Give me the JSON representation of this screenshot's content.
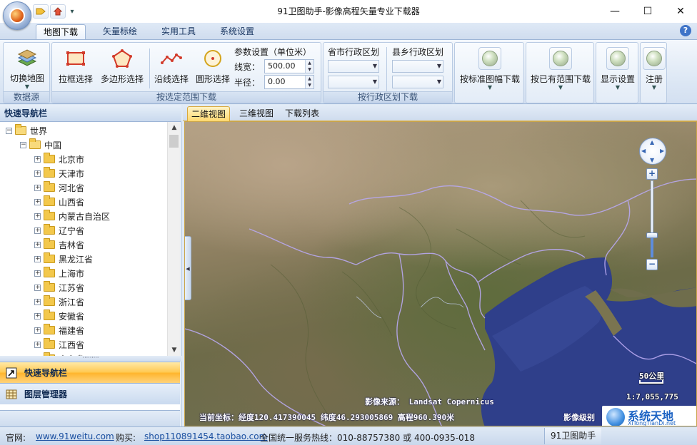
{
  "window": {
    "title": "91卫图助手-影像高程矢量专业下载器",
    "controls": {
      "minimize": "—",
      "maximize": "☐",
      "close": "✕"
    }
  },
  "quick_access": {
    "icons": [
      "tag-icon",
      "home-icon"
    ],
    "dropdown": "▾"
  },
  "ribbon": {
    "tabs": [
      {
        "label": "地图下载",
        "active": true
      },
      {
        "label": "矢量标绘",
        "active": false
      },
      {
        "label": "实用工具",
        "active": false
      },
      {
        "label": "系统设置",
        "active": false
      }
    ],
    "help": "?",
    "groups": {
      "datasource": {
        "label": "数据源",
        "switch_map": "切换地图"
      },
      "range": {
        "label": "按选定范围下载",
        "rect_select": "拉框选择",
        "polygon_select": "多边形选择",
        "line_select": "沿线选择",
        "circle_select": "圆形选择",
        "params_title": "参数设置（单位米）",
        "linewidth_label": "线宽：",
        "linewidth_value": "500.00",
        "radius_label": "半径：",
        "radius_value": "0.00"
      },
      "admin": {
        "label": "按行政区划下载",
        "province_label": "省市行政区划",
        "county_label": "县乡行政区划"
      },
      "others": {
        "standard_sheet": "按标准图幅下载",
        "existing_range": "按已有范围下载",
        "display_settings": "显示设置",
        "register": "注册"
      }
    }
  },
  "left_pane": {
    "header": "快速导航栏",
    "tree": {
      "root": "世界",
      "country": "中国",
      "provinces": [
        "北京市",
        "天津市",
        "河北省",
        "山西省",
        "内蒙古自治区",
        "辽宁省",
        "吉林省",
        "黑龙江省",
        "上海市",
        "江苏省",
        "浙江省",
        "安徽省",
        "福建省",
        "江西省",
        "山东省"
      ]
    },
    "splitter_grip": "·········",
    "nav_items": [
      {
        "label": "快速导航栏",
        "selected": true
      },
      {
        "label": "图层管理器",
        "selected": false
      }
    ]
  },
  "map": {
    "tabs": [
      {
        "label": "二维视图",
        "active": true
      },
      {
        "label": "三维视图",
        "active": false
      },
      {
        "label": "下载列表",
        "active": false
      }
    ],
    "zoom_in": "+",
    "zoom_out": "−",
    "zoom_level_fraction": 0.28,
    "scale_label": "50公里",
    "scale_ratio": "1:7,055,775",
    "source_text": "影像来源： Landsat Copernicus",
    "coords_text": "当前坐标：经度120.417390045 纬度46.293005869 高程960.390米",
    "level_text": "影像级别",
    "watermark": {
      "title": "系统天地",
      "subtitle": "XiTongTianDi.net"
    }
  },
  "statusbar": {
    "website_label": "官网:",
    "website": "www.91weitu.com",
    "buy_label": "购买:",
    "shop": "shop110891454.taobao.com",
    "hotline": "全国统一服务热线：010-88757380 或 400-0935-018",
    "app_name": "91卫图助手"
  },
  "colors": {
    "accent": "#3f74c8",
    "selected_nav": "#ffc74f",
    "sea": "#2f3f8a",
    "border": "#9db5d6"
  }
}
